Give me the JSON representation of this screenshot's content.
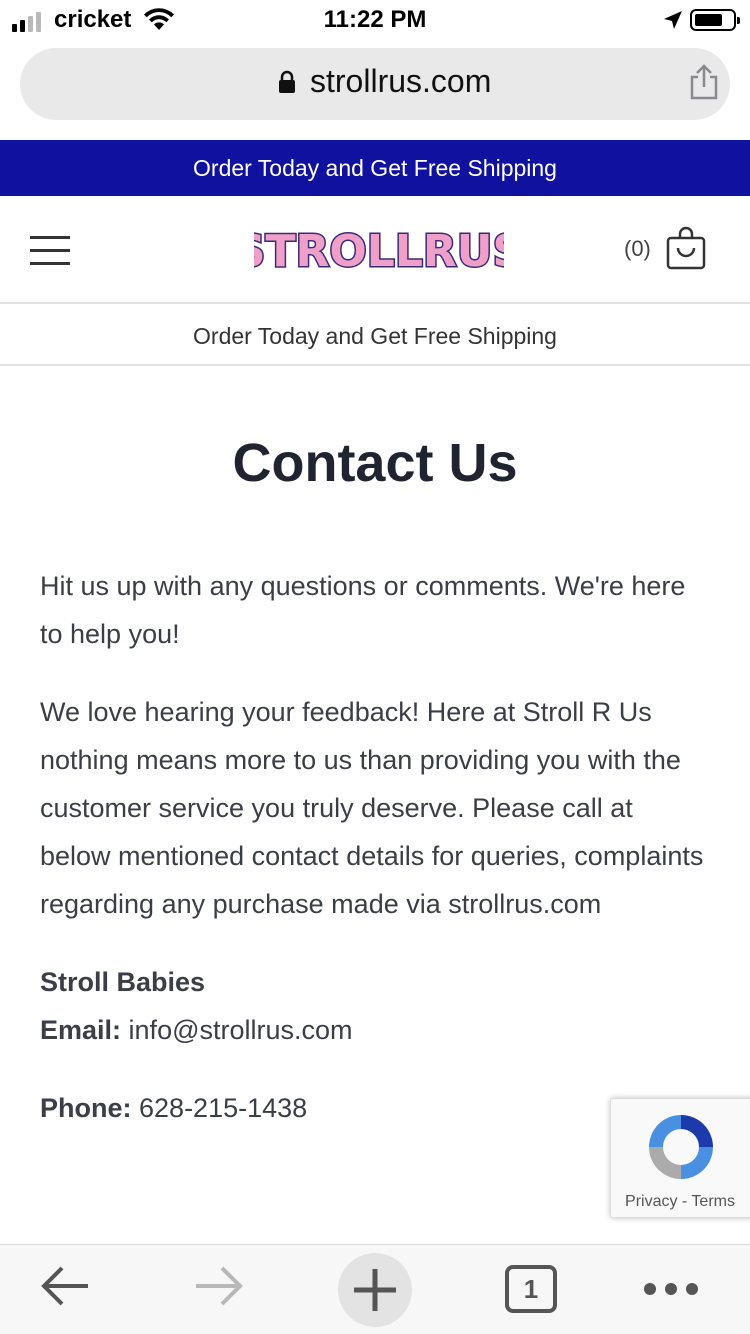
{
  "status_bar": {
    "carrier": "cricket",
    "time": "11:22 PM"
  },
  "browser": {
    "url": "strollrus.com"
  },
  "promo_bar": {
    "text": "Order Today and Get Free Shipping"
  },
  "header": {
    "logo_text": "STROLLRUS",
    "cart_count": "(0)"
  },
  "sub_banner": {
    "text": "Order Today and Get Free Shipping"
  },
  "main": {
    "title": "Contact Us",
    "intro": "Hit us up with any questions or comments. We're here to help you!",
    "body": "We love hearing your feedback!  Here at Stroll R Us nothing means more to us than providing you with the customer service you truly deserve. Please call at below mentioned contact details for queries, complaints regarding any purchase made via strollrus.com",
    "company": "Stroll Babies",
    "email_label": "Email:",
    "email_value": "info@strollrus.com",
    "phone_label": "Phone:",
    "phone_value": "628-215-1438"
  },
  "recaptcha": {
    "links": "Privacy - Terms"
  },
  "toolbar": {
    "tab_count": "1"
  },
  "colors": {
    "promo_bg": "#10119e",
    "title_text": "#1f2430",
    "body_text": "#3a3e46"
  },
  "icons": [
    "lock-icon",
    "share-icon",
    "hamburger-icon",
    "cart-icon",
    "back-arrow-icon",
    "forward-arrow-icon",
    "new-tab-plus-icon",
    "tabs-icon",
    "more-dots-icon",
    "recaptcha-icon",
    "wifi-icon",
    "location-arrow-icon",
    "battery-icon"
  ]
}
